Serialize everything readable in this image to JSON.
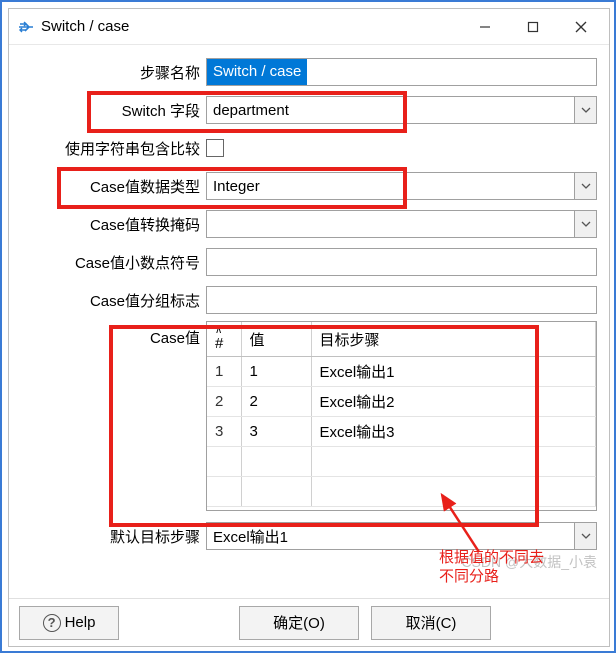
{
  "window": {
    "title": "Switch / case"
  },
  "form": {
    "step_name_label": "步骤名称",
    "step_name_value": "Switch / case",
    "switch_field_label": "Switch 字段",
    "switch_field_value": "department",
    "contains_label": "使用字符串包含比较",
    "case_type_label": "Case值数据类型",
    "case_type_value": "Integer",
    "case_mask_label": "Case值转换掩码",
    "case_mask_value": "",
    "case_decimal_label": "Case值小数点符号",
    "case_decimal_value": "",
    "case_group_label": "Case值分组标志",
    "case_group_value": "",
    "case_values_label": "Case值",
    "table": {
      "col_idx": "#",
      "col_value": "值",
      "col_target": "目标步骤",
      "rows": [
        {
          "n": "1",
          "v": "1",
          "t": "Excel输出1"
        },
        {
          "n": "2",
          "v": "2",
          "t": "Excel输出2"
        },
        {
          "n": "3",
          "v": "3",
          "t": "Excel输出3"
        }
      ]
    },
    "default_target_label": "默认目标步骤",
    "default_target_value": "Excel输出1"
  },
  "footer": {
    "help": "Help",
    "ok": "确定(O)",
    "cancel": "取消(C)"
  },
  "annotation": {
    "text1": "根据值的不同去",
    "text2": "不同分路"
  },
  "watermark": "CSDN @大数据_小袁"
}
